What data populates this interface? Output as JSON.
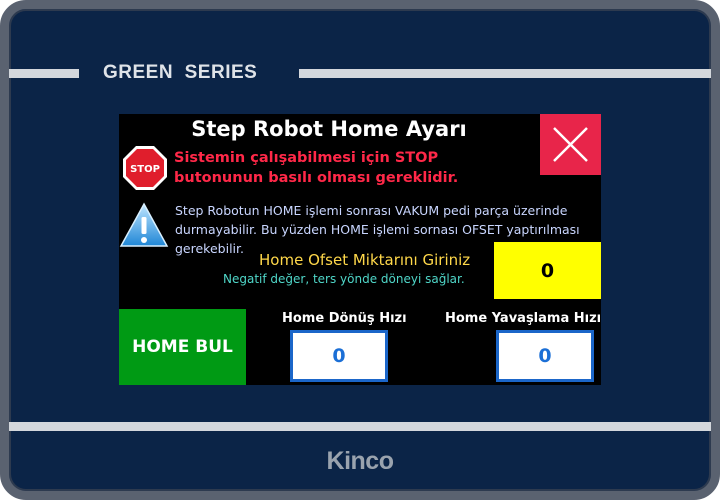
{
  "panel": {
    "series_label": "GREEN  SERIES",
    "brand": "Kinco"
  },
  "screen": {
    "title": "Step Robot Home Ayarı",
    "stop_icon_text": "STOP",
    "stop_warning": [
      "Sistemin çalışabilmesi için STOP",
      "butonunun basılı olması gereklidir."
    ],
    "info_text": "Step Robotun HOME işlemi sonrası VAKUM pedi parça üzerinde durmayabilir. Bu yüzden HOME işlemi sornası OFSET yaptırılması gerekebilir.",
    "offset": {
      "label": "Home Ofset Miktarını Giriniz",
      "hint": "Negatif değer, ters yönde döneyi sağlar.",
      "value": "0"
    },
    "home_bul_label": "HOME BUL",
    "return_speed": {
      "label": "Home Dönüş Hızı",
      "value": "0"
    },
    "slowdown_speed": {
      "label": "Home Yavaşlama Hızı",
      "value": "0"
    }
  },
  "icons": {
    "close": "close-icon",
    "stop": "stop-sign-icon",
    "warning": "warning-icon"
  },
  "colors": {
    "bezel": "#0b2447",
    "close_button": "#e8254a",
    "stop_text": "#ff2848",
    "offset_label": "#ffd84a",
    "offset_hint": "#4fd6c8",
    "offset_input": "#ffff00",
    "home_button": "#009a14",
    "speed_input_border": "#1b66c9"
  }
}
